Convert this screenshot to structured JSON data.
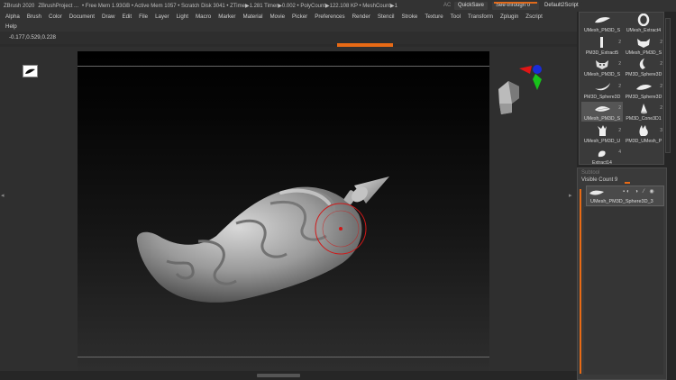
{
  "titlebar": {
    "app": "ZBrush 2020",
    "project": "ZBrushProject ...",
    "stats": "• Free Mem 1.93GB • Active Mem 1057 • Scratch Disk 3041 •  ZTime▶1.281 Timer▶0.002 • PolyCount▶122.108 KP  • MeshCount▶1",
    "ac": "AC",
    "quicksave": "QuickSave",
    "seethrough": "See-through  0",
    "script": "Default2Script"
  },
  "menu": {
    "row1": [
      "Alpha",
      "Brush",
      "Color",
      "Document",
      "Draw",
      "Edit",
      "File",
      "Layer",
      "Light",
      "Macro",
      "Marker",
      "Material",
      "Movie",
      "Picker",
      "Preferences",
      "Render",
      "Stencil",
      "Stroke",
      "Texture",
      "Tool",
      "Transform",
      "Zplugin",
      "Zscript"
    ],
    "row2": [
      "Help"
    ]
  },
  "coords": "-0.177,0.529,0.228",
  "tools": [
    {
      "label": "UMesh_PM3D_S",
      "count": "",
      "icon": "brush-stroke"
    },
    {
      "label": "UMesh_Extract4",
      "count": "",
      "icon": "ring"
    },
    {
      "label": "PM3D_Extract5",
      "count": "2",
      "icon": "bar"
    },
    {
      "label": "UMesh_PM3D_S",
      "count": "2",
      "icon": "mask"
    },
    {
      "label": "UMesh_PM3D_S",
      "count": "2",
      "icon": "mask2"
    },
    {
      "label": "PM3D_Sphere3D",
      "count": "2",
      "icon": "hook"
    },
    {
      "label": "PM3D_Sphere3D",
      "count": "2",
      "icon": "hook2"
    },
    {
      "label": "PM3D_Sphere3D",
      "count": "2",
      "icon": "wedge"
    },
    {
      "label": "UMesh_PM3D_S",
      "count": "2",
      "icon": "feather"
    },
    {
      "label": "PM3D_Cone3D1",
      "count": "2",
      "icon": "cone"
    },
    {
      "label": "UMesh_PM3D_U",
      "count": "2",
      "icon": "claw"
    },
    {
      "label": "PM3D_UMesh_P",
      "count": "3",
      "icon": "bunny"
    },
    {
      "label": "Extract14",
      "count": "4",
      "icon": "stub"
    }
  ],
  "subtool": {
    "header": "Subtool",
    "visible_count": "Visible Count 9",
    "row_label": "UMesh_PM3D_Sphere3D_3"
  }
}
